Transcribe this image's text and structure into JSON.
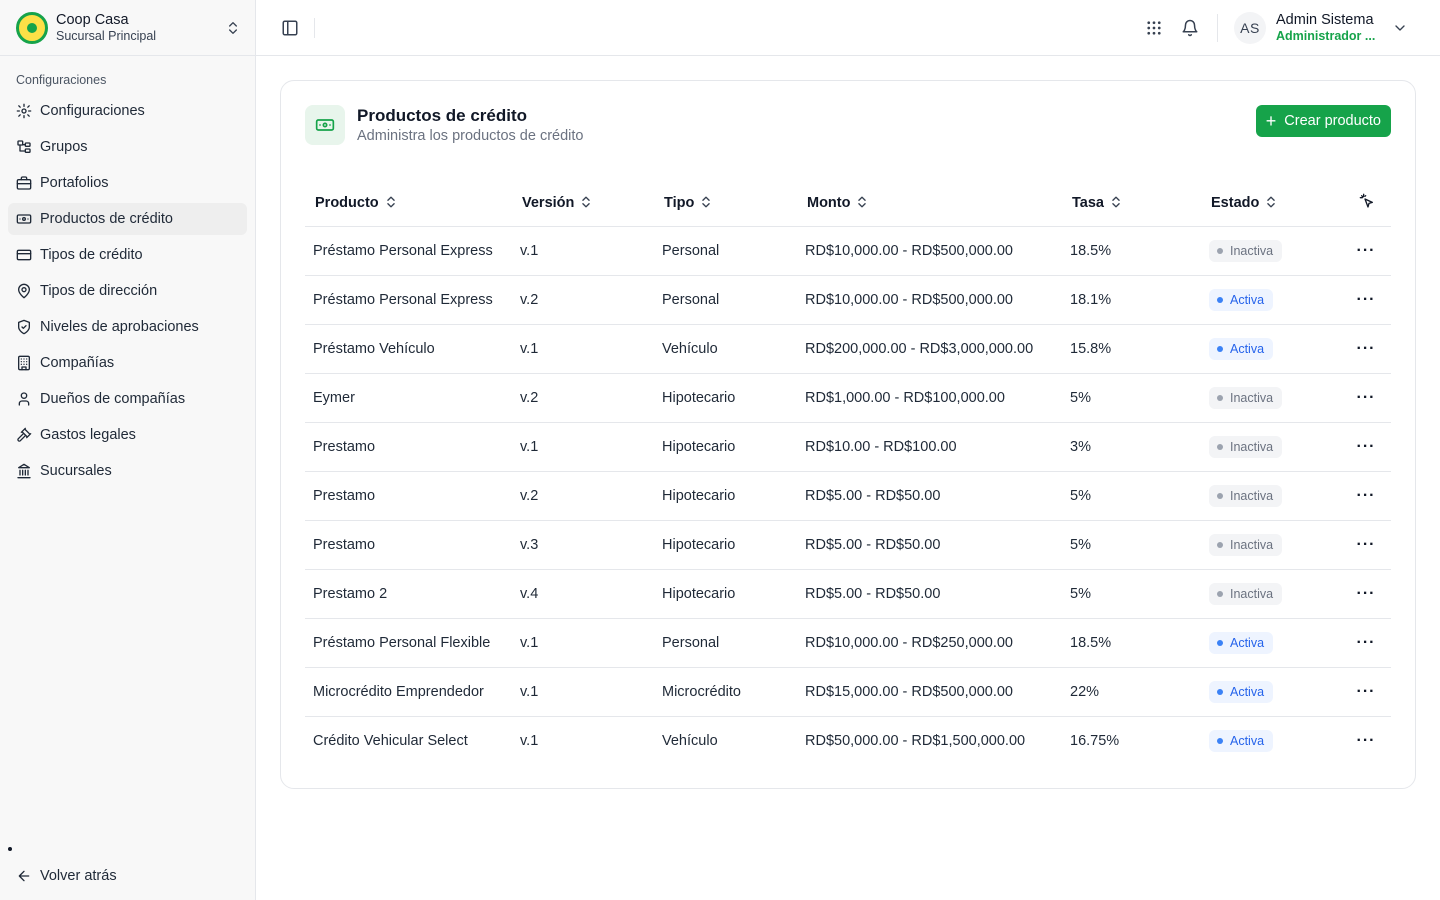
{
  "org": {
    "name": "Coop Casa",
    "branch": "Sucursal Principal"
  },
  "sidebar": {
    "section_label": "Configuraciones",
    "items": [
      {
        "label": "Configuraciones",
        "icon": "gear-icon"
      },
      {
        "label": "Grupos",
        "icon": "tree-icon"
      },
      {
        "label": "Portafolios",
        "icon": "briefcase-icon"
      },
      {
        "label": "Productos de crédito",
        "icon": "money-icon",
        "active": true
      },
      {
        "label": "Tipos de crédito",
        "icon": "credit-card-icon"
      },
      {
        "label": "Tipos de dirección",
        "icon": "map-pin-icon"
      },
      {
        "label": "Niveles de aprobaciones",
        "icon": "shield-check-icon"
      },
      {
        "label": "Compañías",
        "icon": "building-icon"
      },
      {
        "label": "Dueños de compañías",
        "icon": "user-icon"
      },
      {
        "label": "Gastos legales",
        "icon": "gavel-icon"
      },
      {
        "label": "Sucursales",
        "icon": "landmark-icon"
      }
    ],
    "back_label": "Volver atrás"
  },
  "user": {
    "initials": "AS",
    "name": "Admin Sistema",
    "role": "Administrador ..."
  },
  "page": {
    "title": "Productos de crédito",
    "subtitle": "Administra los productos de crédito",
    "create_label": "Crear producto"
  },
  "table": {
    "columns": [
      "Producto",
      "Versión",
      "Tipo",
      "Monto",
      "Tasa",
      "Estado"
    ],
    "rows": [
      {
        "producto": "Préstamo Personal Express",
        "version": "v.1",
        "tipo": "Personal",
        "monto": "RD$10,000.00 - RD$500,000.00",
        "tasa": "18.5%",
        "estado": "Inactiva"
      },
      {
        "producto": "Préstamo Personal Express",
        "version": "v.2",
        "tipo": "Personal",
        "monto": "RD$10,000.00 - RD$500,000.00",
        "tasa": "18.1%",
        "estado": "Activa"
      },
      {
        "producto": "Préstamo Vehículo",
        "version": "v.1",
        "tipo": "Vehículo",
        "monto": "RD$200,000.00 - RD$3,000,000.00",
        "tasa": "15.8%",
        "estado": "Activa"
      },
      {
        "producto": "Eymer",
        "version": "v.2",
        "tipo": "Hipotecario",
        "monto": "RD$1,000.00 - RD$100,000.00",
        "tasa": "5%",
        "estado": "Inactiva"
      },
      {
        "producto": "Prestamo",
        "version": "v.1",
        "tipo": "Hipotecario",
        "monto": "RD$10.00 - RD$100.00",
        "tasa": "3%",
        "estado": "Inactiva"
      },
      {
        "producto": "Prestamo",
        "version": "v.2",
        "tipo": "Hipotecario",
        "monto": "RD$5.00 - RD$50.00",
        "tasa": "5%",
        "estado": "Inactiva"
      },
      {
        "producto": "Prestamo",
        "version": "v.3",
        "tipo": "Hipotecario",
        "monto": "RD$5.00 - RD$50.00",
        "tasa": "5%",
        "estado": "Inactiva"
      },
      {
        "producto": "Prestamo 2",
        "version": "v.4",
        "tipo": "Hipotecario",
        "monto": "RD$5.00 - RD$50.00",
        "tasa": "5%",
        "estado": "Inactiva"
      },
      {
        "producto": "Préstamo Personal Flexible",
        "version": "v.1",
        "tipo": "Personal",
        "monto": "RD$10,000.00 - RD$250,000.00",
        "tasa": "18.5%",
        "estado": "Activa"
      },
      {
        "producto": "Microcrédito Emprendedor",
        "version": "v.1",
        "tipo": "Microcrédito",
        "monto": "RD$15,000.00 - RD$500,000.00",
        "tasa": "22%",
        "estado": "Activa"
      },
      {
        "producto": "Crédito Vehicular Select",
        "version": "v.1",
        "tipo": "Vehículo",
        "monto": "RD$50,000.00 - RD$1,500,000.00",
        "tasa": "16.75%",
        "estado": "Activa"
      }
    ]
  },
  "colors": {
    "accent": "#16a34a",
    "active_badge": "#2563eb",
    "inactive_badge": "#6b7280"
  }
}
